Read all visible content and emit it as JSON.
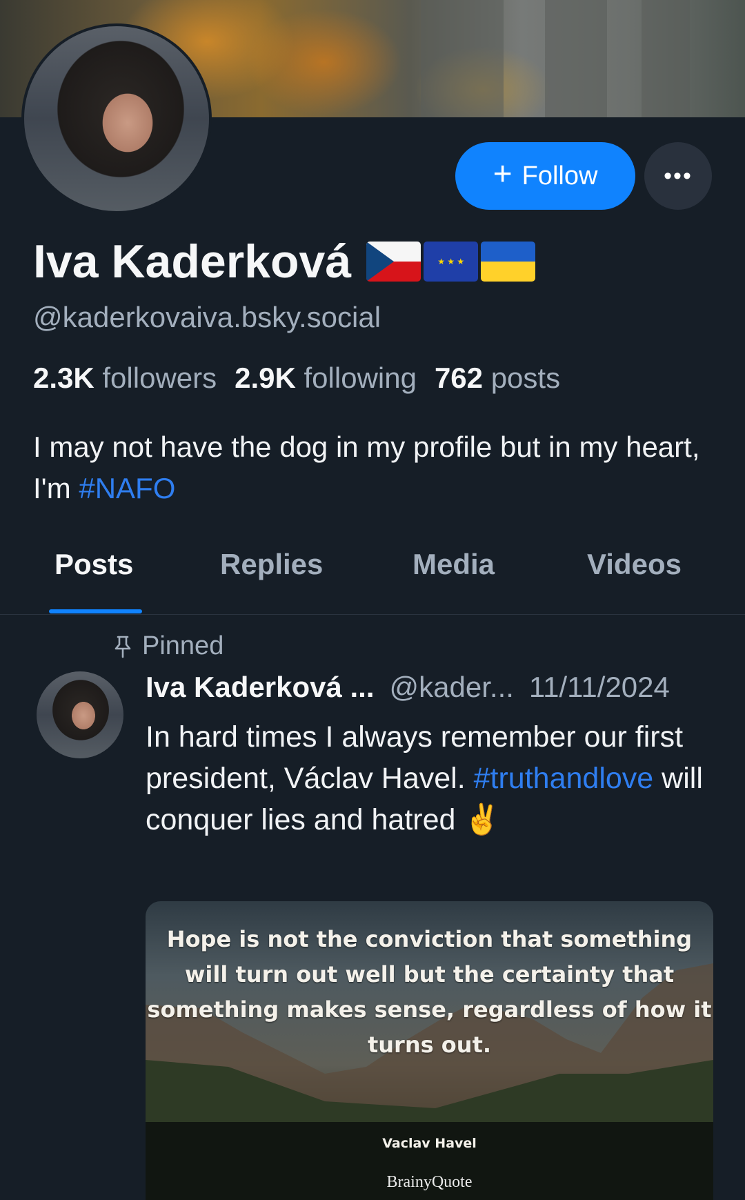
{
  "profile": {
    "display_name": "Iva Kaderková",
    "flags": [
      "czech-flag",
      "eu-flag",
      "ukraine-flag"
    ],
    "handle": "@kaderkovaiva.bsky.social",
    "followers_count": "2.3K",
    "followers_label": "followers",
    "following_count": "2.9K",
    "following_label": "following",
    "posts_count": "762",
    "posts_label": "posts",
    "bio_text": "I may not have the dog in my profile but in my heart, I'm ",
    "bio_hashtag": "#NAFO"
  },
  "actions": {
    "follow_label": "Follow",
    "more_label": "•••"
  },
  "tabs": [
    {
      "label": "Posts",
      "active": true
    },
    {
      "label": "Replies",
      "active": false
    },
    {
      "label": "Media",
      "active": false
    },
    {
      "label": "Videos",
      "active": false
    }
  ],
  "pinned_post": {
    "pinned_label": "Pinned",
    "author": "Iva Kaderková ...",
    "handle": "@kader...",
    "date": "11/11/2024",
    "text_1": "In hard times I always remember our first president, Václav Havel. ",
    "hashtag": "#truthandlove",
    "text_2": " will conquer lies and hatred ✌️",
    "image": {
      "quote": "Hope is not the conviction that something will turn out well but the certainty that something makes sense, regardless of how it turns out.",
      "quote_author": "Vaclav Havel",
      "brand": "BrainyQuote"
    }
  },
  "colors": {
    "background": "#161e27",
    "accent": "#1083fe",
    "muted_text": "#a3afbd",
    "link": "#2f7ef0"
  }
}
